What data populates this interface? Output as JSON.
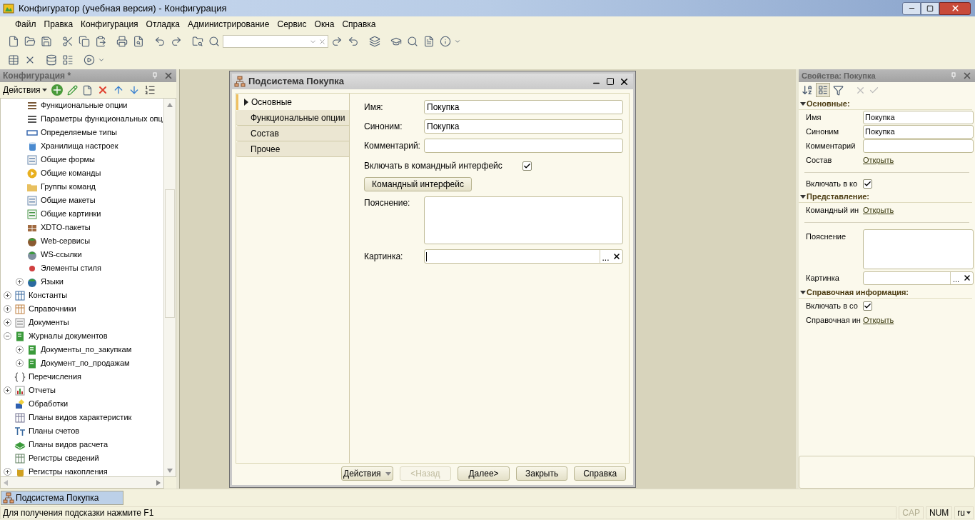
{
  "window": {
    "title": "Конфигуратор (учебная версия) - Конфигурация"
  },
  "menu": [
    "Файл",
    "Правка",
    "Конфигурация",
    "Отладка",
    "Администрирование",
    "Сервис",
    "Окна",
    "Справка"
  ],
  "config_panel": {
    "title": "Конфигурация *",
    "actions_label": "Действия",
    "tree": {
      "partial_group": [
        {
          "label": "Функциональные опции",
          "kind": "options"
        },
        {
          "label": "Параметры функциональных опц",
          "kind": "params"
        },
        {
          "label": "Определяемые типы",
          "kind": "types"
        },
        {
          "label": "Хранилища настроек",
          "kind": "storage"
        },
        {
          "label": "Общие формы",
          "kind": "form"
        },
        {
          "label": "Общие команды",
          "kind": "command"
        },
        {
          "label": "Группы команд",
          "kind": "folder"
        },
        {
          "label": "Общие макеты",
          "kind": "form"
        },
        {
          "label": "Общие картинки",
          "kind": "image"
        },
        {
          "label": "XDTO-пакеты",
          "kind": "xdto"
        },
        {
          "label": "Web-сервисы",
          "kind": "web"
        },
        {
          "label": "WS-ссылки",
          "kind": "ws"
        },
        {
          "label": "Элементы стиля",
          "kind": "style"
        },
        {
          "label": "Языки",
          "kind": "lang",
          "expanded": false
        }
      ],
      "items": [
        {
          "label": "Константы",
          "kind": "const",
          "expanded": false
        },
        {
          "label": "Справочники",
          "kind": "catalog",
          "expanded": false
        },
        {
          "label": "Документы",
          "kind": "doc",
          "expanded": false
        },
        {
          "label": "Журналы документов",
          "kind": "journal",
          "expanded": true,
          "children": [
            {
              "label": "Документы_по_закупкам",
              "kind": "journal",
              "expanded": false
            },
            {
              "label": "Документ_по_продажам",
              "kind": "journal",
              "expanded": false
            }
          ]
        },
        {
          "label": "Перечисления",
          "kind": "enum"
        },
        {
          "label": "Отчеты",
          "kind": "report",
          "expanded": false
        },
        {
          "label": "Обработки",
          "kind": "processing"
        },
        {
          "label": "Планы видов характеристик",
          "kind": "chars"
        },
        {
          "label": "Планы счетов",
          "kind": "accounts"
        },
        {
          "label": "Планы видов расчета",
          "kind": "calc"
        },
        {
          "label": "Регистры сведений",
          "kind": "inforeg"
        },
        {
          "label": "Регистры накопления",
          "kind": "accumreg",
          "expanded": false
        }
      ]
    }
  },
  "dialog": {
    "title": "Подсистема Покупка",
    "tabs": [
      {
        "label": "Основные",
        "selected": true
      },
      {
        "label": "Функциональные опции",
        "selected": false
      },
      {
        "label": "Состав",
        "selected": false
      },
      {
        "label": "Прочее",
        "selected": false
      }
    ],
    "fields": [
      {
        "label": "Имя:",
        "value": "Покупка"
      },
      {
        "label": "Синоним:",
        "value": "Покупка"
      },
      {
        "label": "Комментарий:"
      }
    ],
    "include_checkbox": {
      "label": "Включать в командный интерфейс",
      "checked": true
    },
    "command_button": "Командный интерфейс",
    "explanation_label": "Пояснение:",
    "picture_label": "Картинка:",
    "picture_button": "...",
    "buttons": [
      {
        "label": "Действия",
        "kind": "menu",
        "disabled": false
      },
      {
        "label": "<Назад",
        "kind": "plain",
        "disabled": true
      },
      {
        "label": "Далее>",
        "kind": "plain",
        "disabled": false
      },
      {
        "label": "Закрыть",
        "kind": "plain",
        "disabled": false
      },
      {
        "label": "Справка",
        "kind": "plain",
        "disabled": false
      }
    ]
  },
  "properties": {
    "title": "Свойства: Покупка",
    "groups": [
      {
        "title": "Основные:",
        "rows": [
          {
            "kind": "field",
            "label": "Имя",
            "value": "Покупка"
          },
          {
            "kind": "field",
            "label": "Синоним",
            "value": "Покупка"
          },
          {
            "kind": "field",
            "label": "Комментарий"
          },
          {
            "kind": "link",
            "label": "Состав",
            "link": "Открыть"
          },
          {
            "kind": "separator"
          },
          {
            "kind": "checkbox",
            "label": "Включать в ко",
            "checked": true
          }
        ]
      },
      {
        "title": "Представление:",
        "rows": [
          {
            "kind": "link",
            "label": "Командный ин",
            "link": "Открыть"
          },
          {
            "kind": "separator"
          },
          {
            "kind": "textarea",
            "label": "Пояснение"
          },
          {
            "kind": "picture",
            "label": "Картинка",
            "button": "..."
          }
        ]
      },
      {
        "title": "Справочная информация:",
        "rows": [
          {
            "kind": "checkbox",
            "label": "Включать в со",
            "checked": true
          },
          {
            "kind": "link",
            "label": "Справочная ин",
            "link": "Открыть"
          }
        ]
      }
    ]
  },
  "window_tabs": [
    {
      "label": "Подсистема Покупка",
      "selected": true
    }
  ],
  "status_bar": {
    "hint": "Для получения подсказки нажмите F1",
    "indicators": [
      {
        "label": "CAP",
        "on": false
      },
      {
        "label": "NUM",
        "on": true
      }
    ],
    "language": "ru"
  }
}
